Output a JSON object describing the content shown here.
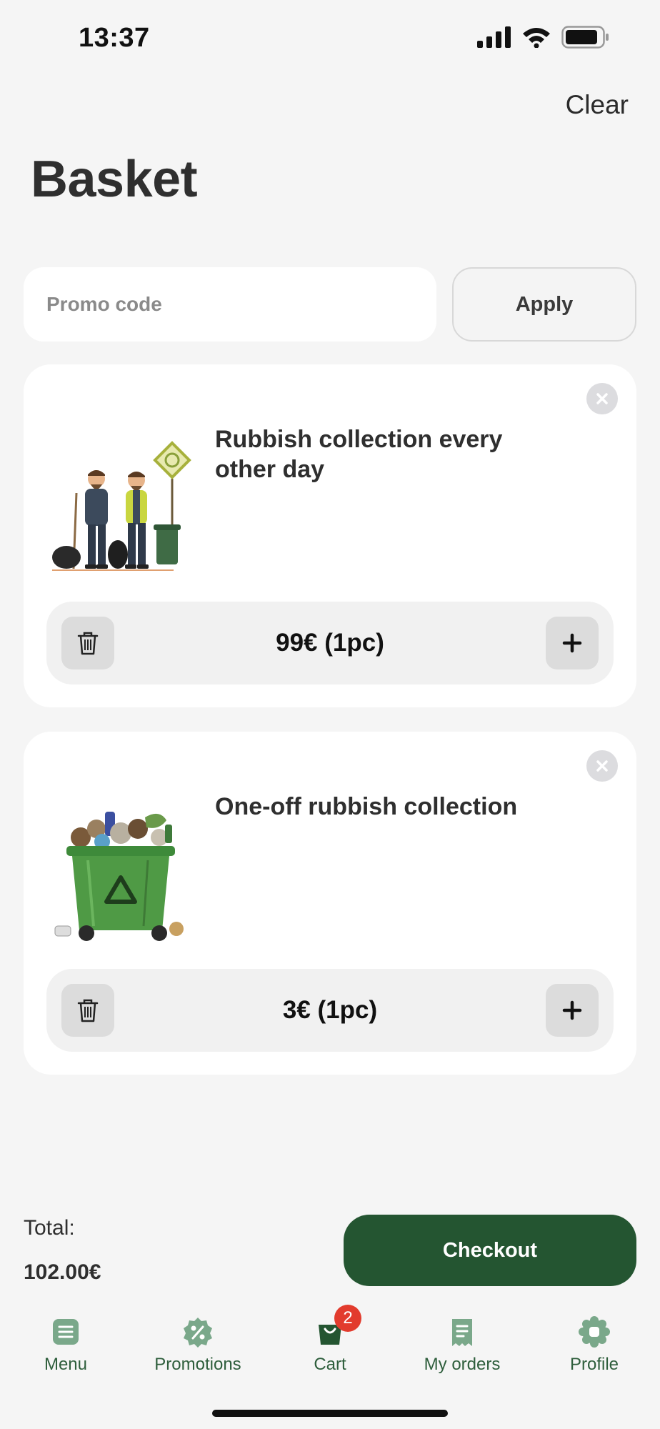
{
  "status_bar": {
    "time": "13:37"
  },
  "header": {
    "clear_label": "Clear",
    "title": "Basket"
  },
  "promo": {
    "placeholder": "Promo code",
    "value": "",
    "apply_label": "Apply"
  },
  "items": [
    {
      "title": "Rubbish collection every other day",
      "price_qty": "99€ (1pc)",
      "image": "workers-illustration"
    },
    {
      "title": "One-off rubbish collection",
      "price_qty": "3€ (1pc)",
      "image": "recycling-bin-illustration"
    }
  ],
  "footer": {
    "total_label": "Total:",
    "total_value": "102.00€",
    "checkout_label": "Checkout"
  },
  "tabs": [
    {
      "label": "Menu",
      "icon": "menu-icon"
    },
    {
      "label": "Promotions",
      "icon": "percent-badge-icon"
    },
    {
      "label": "Cart",
      "icon": "shopping-bag-icon",
      "badge": "2"
    },
    {
      "label": "My orders",
      "icon": "receipt-icon"
    },
    {
      "label": "Profile",
      "icon": "profile-icon"
    }
  ],
  "colors": {
    "primary": "#245531",
    "tab_icon": "#7aa88a",
    "tab_active_icon": "#245531",
    "badge": "#e23b2d"
  }
}
